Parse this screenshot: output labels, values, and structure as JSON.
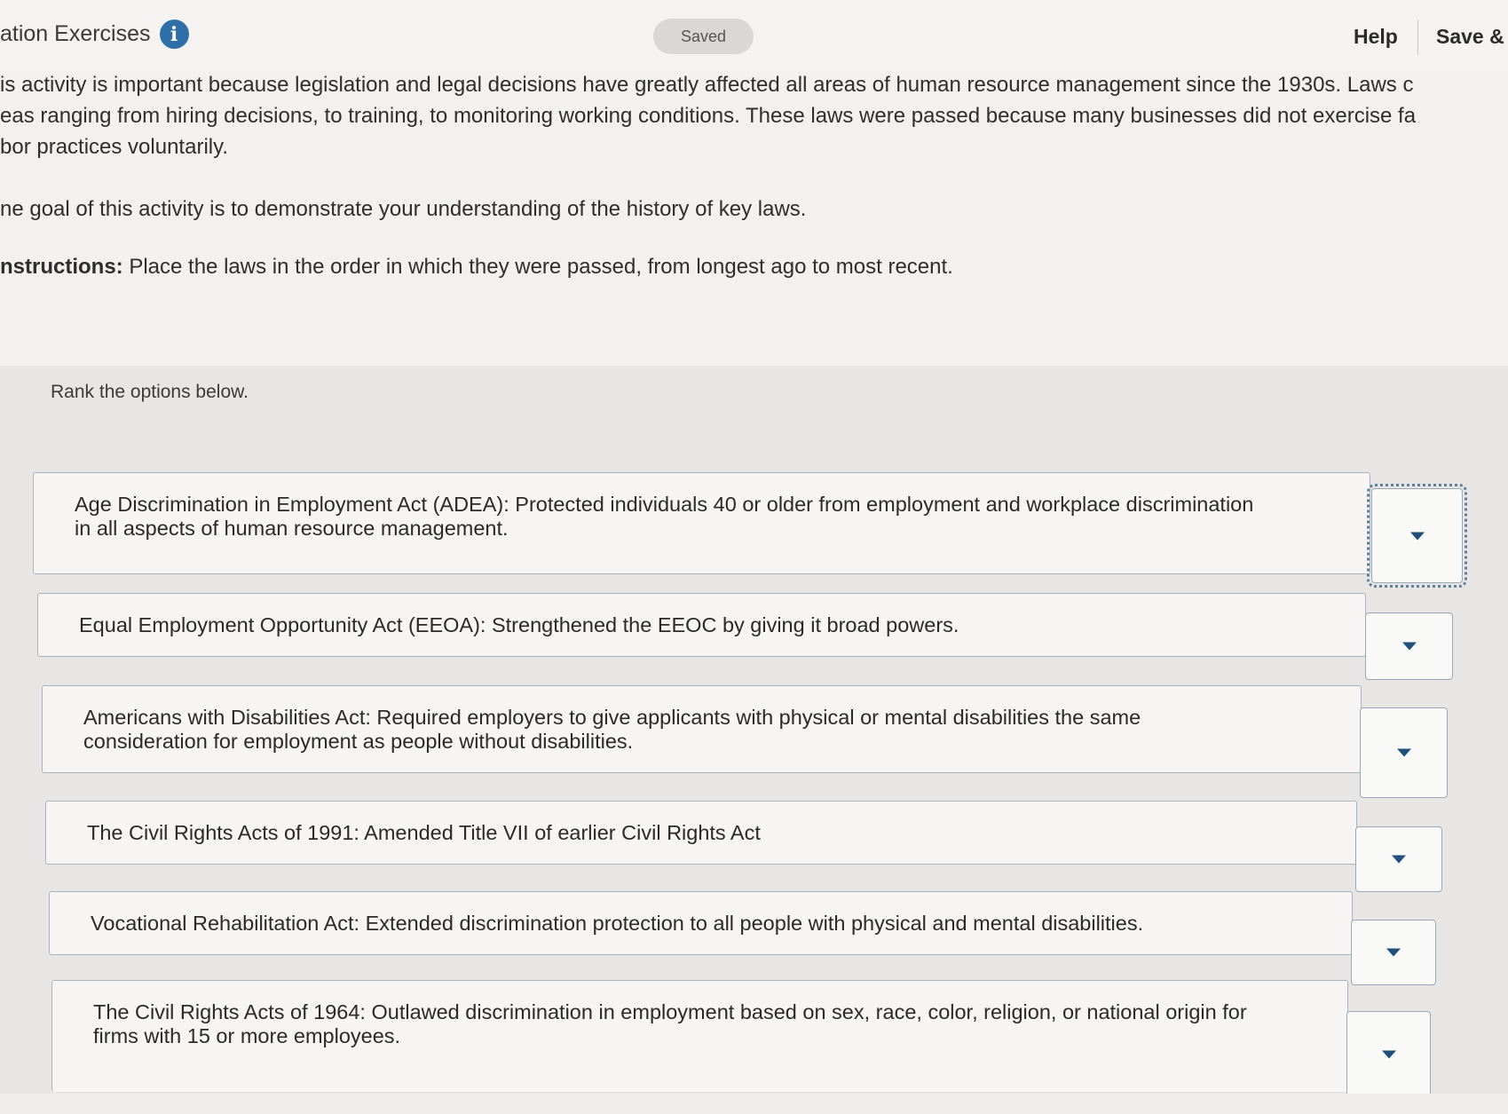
{
  "header": {
    "title": "ation Exercises",
    "info_icon": "info-icon",
    "saved_label": "Saved",
    "help_label": "Help",
    "save_label": "Save &"
  },
  "intro": {
    "paragraph1_line1": "is activity is important because legislation and legal decisions have greatly affected all areas of human resource management since the 1930s. Laws c",
    "paragraph1_line2": "eas ranging from hiring decisions, to training, to monitoring working conditions. These laws were passed because many businesses did not exercise fa",
    "paragraph1_line3": "bor practices voluntarily.",
    "paragraph2": "ne goal of this activity is to demonstrate your understanding of the history of key laws.",
    "instructions_label": "nstructions:",
    "instructions_text": " Place the laws in the order in which they were passed, from longest ago to most recent."
  },
  "ranking": {
    "prompt": "Rank the options below.",
    "items": [
      {
        "line1": "Age Discrimination in Employment Act (ADEA): Protected individuals 40 or older from employment and workplace discrimination",
        "line2": "in all aspects of human resource management.",
        "dropdown_icon": "chevron-down-icon"
      },
      {
        "line1": "Equal Employment Opportunity Act (EEOA): Strengthened the EEOC by giving it broad powers.",
        "line2": "",
        "dropdown_icon": "chevron-down-icon"
      },
      {
        "line1": "Americans with Disabilities Act: Required employers to give applicants with physical or mental disabilities the same",
        "line2": "consideration for employment as people without disabilities.",
        "dropdown_icon": "chevron-down-icon"
      },
      {
        "line1": "The Civil Rights Acts of 1991: Amended Title VII of earlier Civil Rights Act",
        "line2": "",
        "dropdown_icon": "chevron-down-icon"
      },
      {
        "line1": "Vocational Rehabilitation Act: Extended discrimination protection to all people with physical and mental disabilities.",
        "line2": "",
        "dropdown_icon": "chevron-down-icon"
      },
      {
        "line1": "The Civil Rights Acts of 1964: Outlawed discrimination in employment based on sex, race, color, religion, or national origin for",
        "line2": "firms with 15 or more employees.",
        "dropdown_icon": "chevron-down-icon"
      }
    ]
  },
  "colors": {
    "info_icon": "#2f6fa7",
    "caret": "#1f4f7a",
    "panel_bg": "#e7e6e4"
  }
}
